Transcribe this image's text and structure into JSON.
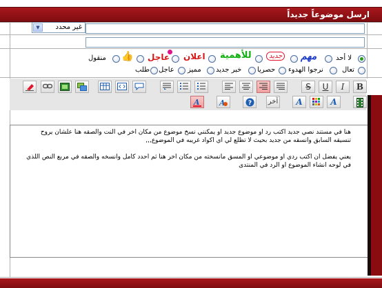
{
  "header": {
    "title": "ارسل موضوعاً جديداً"
  },
  "prefix": {
    "selected": "غير محدد"
  },
  "title_field": {
    "value": "",
    "placeholder": ""
  },
  "desc_field": {
    "value": "",
    "placeholder": ""
  },
  "icons_row1": [
    {
      "label": "لا أحد",
      "selected": true
    },
    {
      "label": "مهم",
      "color": "#1a3cc7"
    },
    {
      "label": "جديد",
      "color": "#e0142a"
    },
    {
      "label": "للأهمية",
      "color": "#10b010"
    },
    {
      "label": "اعلان",
      "color": "#d81414"
    },
    {
      "label": "عاجل",
      "color": "#d81414"
    },
    {
      "label": "thumbs-up-icon"
    },
    {
      "label": "منقول"
    }
  ],
  "icons_row2": [
    {
      "label": "تعال"
    },
    {
      "label": "نرجوا الهدوء"
    },
    {
      "label": "حصريا"
    },
    {
      "label": "خبر جديد"
    },
    {
      "label": "مميز"
    },
    {
      "label": "عاجل"
    },
    {
      "label": "طلب"
    }
  ],
  "toolbar": {
    "bold": "B",
    "italic": "I",
    "underline": "U",
    "strike": "S",
    "last": "آخر"
  },
  "editor": {
    "para1_line1": "هنا في مستند نصي جديد اكتب رد او موضوع جديد او يمكنني نسخ موضوع من مكان اخر في النت والصقه هنا علشان يروح",
    "para1_line2": "تنسيقه السابق وانسقه من جديد بحيث لا تظلع لي اي اكواد غريبه في الموضوع,,,",
    "para2_line1": "يعني يفضل ان اكتب ردي او موضوعي او المسق مانسخته من مكان اخر هنا ثم احدد كامل وانسخه والصقه في مربع النص اللذي",
    "para2_line2": "في لوحه انشاء الموضوع او الرد في المنتدى"
  },
  "colors": {
    "accent": "#8a0c10",
    "active_button": "#f0a0a0"
  }
}
